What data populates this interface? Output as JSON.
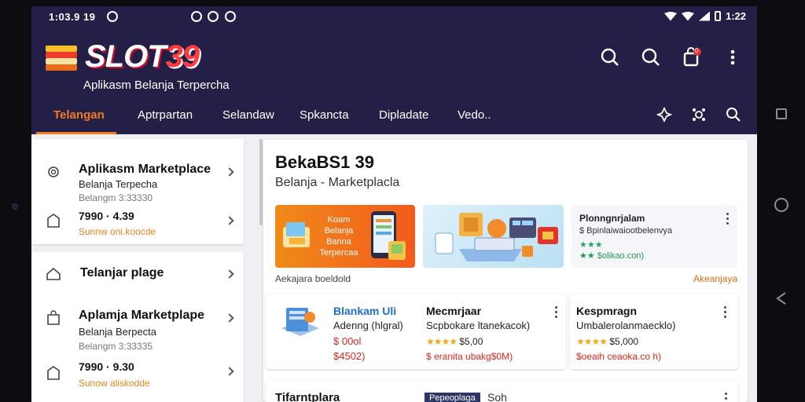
{
  "status_bar": {
    "time": "1:03.9 19",
    "clock_right": "1:22",
    "icons": [
      "app-notification-icon",
      "smiley-icon",
      "alarm-icon",
      "wifi-icon",
      "signal-icon",
      "battery-icon"
    ]
  },
  "app": {
    "logo_text": "SLOT",
    "logo_number": "39",
    "tagline": "Aplikasm Belanja Terpercha"
  },
  "header_icons": [
    "search-icon",
    "search-icon",
    "cart-icon",
    "more-vert-icon"
  ],
  "cart_badge": "0",
  "tabs": [
    {
      "label": "Telangan",
      "active": true
    },
    {
      "label": "Aptrpartan",
      "active": false
    },
    {
      "label": "Selandaw",
      "active": false
    },
    {
      "label": "Spkancta",
      "active": false
    },
    {
      "label": "Dipladate",
      "active": false
    },
    {
      "label": "Vedo..",
      "active": false
    }
  ],
  "tab_icons": [
    "pin-icon",
    "settings-share-icon",
    "search-icon"
  ],
  "sidebar": {
    "card1": {
      "item1": {
        "title": "Aplikasm Marketplace",
        "subtitle": "Belanja Terpecha",
        "meta": "Belangm 3:33330"
      },
      "item2": {
        "price": "7990 · 4.39",
        "link": "Sunnw oni.koocde"
      }
    },
    "card2": {
      "item1": {
        "title": "Telanjar plage"
      },
      "item2": {
        "title": "Aplamja Marketplape",
        "subtitle": "Belanja Berpecta",
        "meta": "Belangm 3:33335"
      },
      "item3": {
        "price": "7990 · 9.30",
        "link": "Sunow aliskodde"
      }
    }
  },
  "main": {
    "title": "BekaBS1 39",
    "subtitle": "Belanja - Marketplacla",
    "banner1_lines": [
      "Koam",
      "Belanja",
      "Banna",
      "Terpercaa"
    ],
    "banner3": {
      "title": "Plonngnrjalam",
      "subtitle": "$ Bpinlaiwaiootbelenvya",
      "stars": "★★★",
      "reviews": "★★ $olikao.con)"
    },
    "caption_left": "Aekajara boeldold",
    "caption_right": "Akeanjaya",
    "products": [
      {
        "title": "Blankam Uli",
        "line": "Adenng (hlgral)",
        "price": "$ 00ol",
        "price2": "$4502)"
      },
      {
        "title": "Mecmrjaar",
        "line": "Scpbokare ltanekacok)",
        "stars": "★★★★",
        "price": "$5,00",
        "sold": "$ eranita ubakg$0M)"
      },
      {
        "title": "Kespmragn",
        "line": "Umbalerolanmaecklo)",
        "stars": "★★★★",
        "price": "$5,000",
        "sold": "$oeaih ceaoka.co h)"
      }
    ],
    "bottom": {
      "title": "Tifarntplara",
      "badge": "Pepeoplaga",
      "sort": "Soh"
    }
  },
  "colors": {
    "header_bg": "#241f46",
    "accent": "#f27a1f",
    "price_red": "#d8281d",
    "star": "#f2a81c"
  }
}
